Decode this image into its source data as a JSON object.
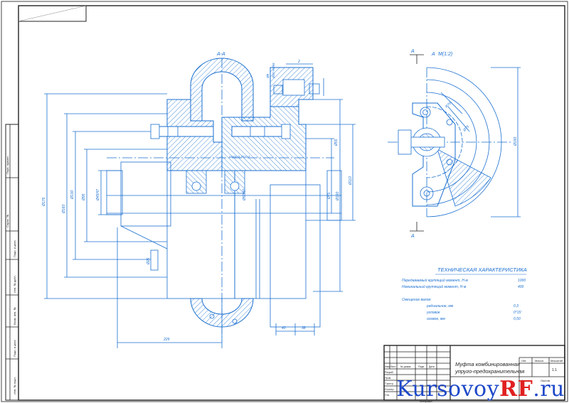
{
  "section_label": "А-А",
  "view_label": "А",
  "view_scale": "М(1:2)",
  "view_arrow_top": "А",
  "view_arrow_bottom": "А",
  "tech": {
    "title": "ТЕХНИЧЕСКАЯ ХАРАКТЕРИСТИКА",
    "lines": [
      "Передаваемый крутящий момент, Н·м",
      "Номинальный крутящий момент, Н·м",
      "Смещение валов:",
      "радиальное, мм",
      "угловое",
      "осевое, мм"
    ],
    "values": [
      "1000",
      "400",
      "0,3",
      "0°15'",
      "0,50"
    ]
  },
  "title_block": {
    "name_line1": "Муфта комбинированная",
    "name_line2": "упруго-предохранительная",
    "col_headers": [
      "Лит.",
      "Масса",
      "Масштаб"
    ],
    "scale": "1:1",
    "sheet": "Лист",
    "sheets": "Листов",
    "rows": [
      "Изм.",
      "Лист",
      "№ докум.",
      "Подп.",
      "Дата",
      "Разраб.",
      "Пров.",
      "Т.контр.",
      "Н.контр.",
      "Утв."
    ],
    "format": "Формат А2",
    "copied": "Копировал"
  },
  "left_strip": [
    "Перв. примен.",
    "Справ. №",
    "Подп. и дата",
    "Инв. № дубл.",
    "Взам. инв. №",
    "Подп. и дата",
    "Инв. № подл."
  ],
  "dims": {
    "d_outer": "Ø176",
    "d_flange": "Ø160",
    "d_mid": "Ø130",
    "d_hub": "Ø95",
    "d_bore": "Ø45H7",
    "d_bore2": "Ø50H7",
    "d_right1": "Ø110",
    "d_right2": "Ø75",
    "d_right3": "Ø55",
    "len_total": "229",
    "len_a": "40",
    "len_b": "38",
    "gap": "2",
    "pin": "Ø8",
    "fit": "Ø10 H7/k6",
    "clear": "зазор 0,25-0,7",
    "right_h": "Ø190",
    "rr": "R70",
    "wm": "Ø25"
  },
  "watermark": {
    "main": "Kursovoy",
    "accent": "RF",
    "tld": ".ru"
  }
}
